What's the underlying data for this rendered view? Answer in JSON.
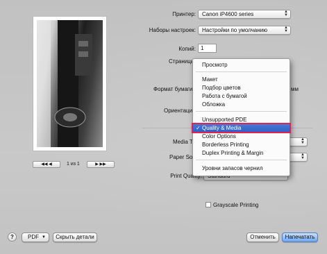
{
  "dialog": {
    "printer_label": "Принтер:",
    "printer_value": "Canon iP4600 series",
    "presets_label": "Наборы настроек:",
    "presets_value": "Настройки по умолчанию",
    "copies_label": "Копий:",
    "copies_value": "1",
    "pages_label": "Страницы",
    "paper_format_label": "Формат бумаги",
    "paper_format_suffix": "мм",
    "orientation_label": "Ориентация",
    "media_type_label": "Media T",
    "paper_source_label": "Paper Sou",
    "print_quality_label": "Print Quality:",
    "print_quality_value": "Standard",
    "grayscale_label": "Grayscale Printing"
  },
  "preview": {
    "page_indicator": "1 из 1",
    "first_prev": "◀◀ ◀",
    "next_last": "▶ ▶▶"
  },
  "section_menu": {
    "items": [
      {
        "label": "Просмотр"
      },
      {
        "label": "Макет"
      },
      {
        "label": "Подбор цветов"
      },
      {
        "label": "Работа с бумагой"
      },
      {
        "label": "Обложка"
      },
      {
        "label": "Unsupported PDE"
      },
      {
        "label": "Quality & Media",
        "selected": true
      },
      {
        "label": "Color Options"
      },
      {
        "label": "Borderless Printing"
      },
      {
        "label": "Duplex Printing & Margin"
      },
      {
        "label": "Уровни запасов чернил"
      }
    ],
    "check_mark": "✓"
  },
  "footer": {
    "help": "?",
    "pdf": "PDF",
    "hide_details": "Скрыть детали",
    "cancel": "Отменить",
    "print": "Напечатать"
  },
  "colors": {
    "selection": "#2f5fc6",
    "highlight_outline": "#e0244c",
    "primary_button": "#6ea6ef"
  }
}
